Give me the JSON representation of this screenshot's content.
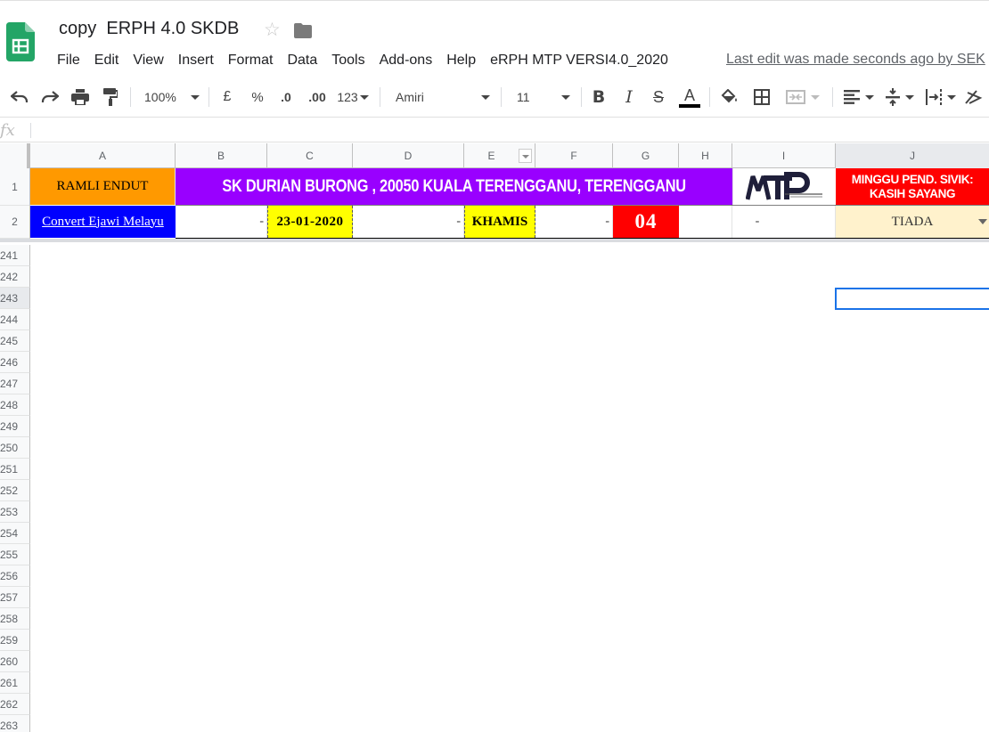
{
  "header": {
    "title": "copy  ERPH 4.0 SKDB",
    "menu": [
      "File",
      "Edit",
      "View",
      "Insert",
      "Format",
      "Data",
      "Tools",
      "Add-ons",
      "Help",
      "eRPH MTP VERSI4.0_2020"
    ],
    "last_edit": "Last edit was made seconds ago by SEK"
  },
  "toolbar": {
    "zoom": "100%",
    "currency": "£",
    "percent": "%",
    "dec_decrease": ".0",
    "dec_increase": ".00",
    "more_formats": "123",
    "font": "Amiri",
    "font_size": "11",
    "icons": [
      "undo-icon",
      "redo-icon",
      "print-icon",
      "paint-format-icon",
      "bold-icon",
      "italic-icon",
      "strikethrough-icon",
      "text-color-icon",
      "fill-color-icon",
      "borders-icon",
      "merge-cells-icon",
      "horizontal-align-icon",
      "vertical-align-icon",
      "text-wrap-icon",
      "text-rotate-icon"
    ]
  },
  "formula_bar": {
    "label": "fx",
    "value": ""
  },
  "columns": [
    "A",
    "B",
    "C",
    "D",
    "E",
    "F",
    "G",
    "H",
    "I",
    "J"
  ],
  "rows": {
    "frozen": [
      "1",
      "2"
    ],
    "visible": [
      "241",
      "242",
      "243",
      "244",
      "245",
      "246",
      "247",
      "248",
      "249",
      "250",
      "251",
      "252",
      "253",
      "254",
      "255",
      "256",
      "257",
      "258",
      "259",
      "260",
      "261",
      "262",
      "263"
    ]
  },
  "cells": {
    "a1": "RAMLI ENDUT",
    "b1": "SK DURIAN BURONG , 20050 KUALA TERENGGANU, TERENGGANU",
    "i1_logo": "MTP",
    "j1_line1": "MINGGU PEND. SIVIK:",
    "j1_line2": "KASIH SAYANG",
    "a2": "Convert Ejawi Melayu",
    "b2": "-",
    "c2": "23-01-2020",
    "d2": "-",
    "e2": "KHAMIS",
    "f2": "-",
    "g2": "04",
    "i2": "-",
    "j2": "TIADA"
  },
  "colors": {
    "orange": "#ff9900",
    "purple": "#9900ff",
    "red": "#ff0000",
    "blue": "#0000ff",
    "yellow": "#ffff00",
    "cream": "#fff2cc",
    "selection": "#1a73e8"
  }
}
